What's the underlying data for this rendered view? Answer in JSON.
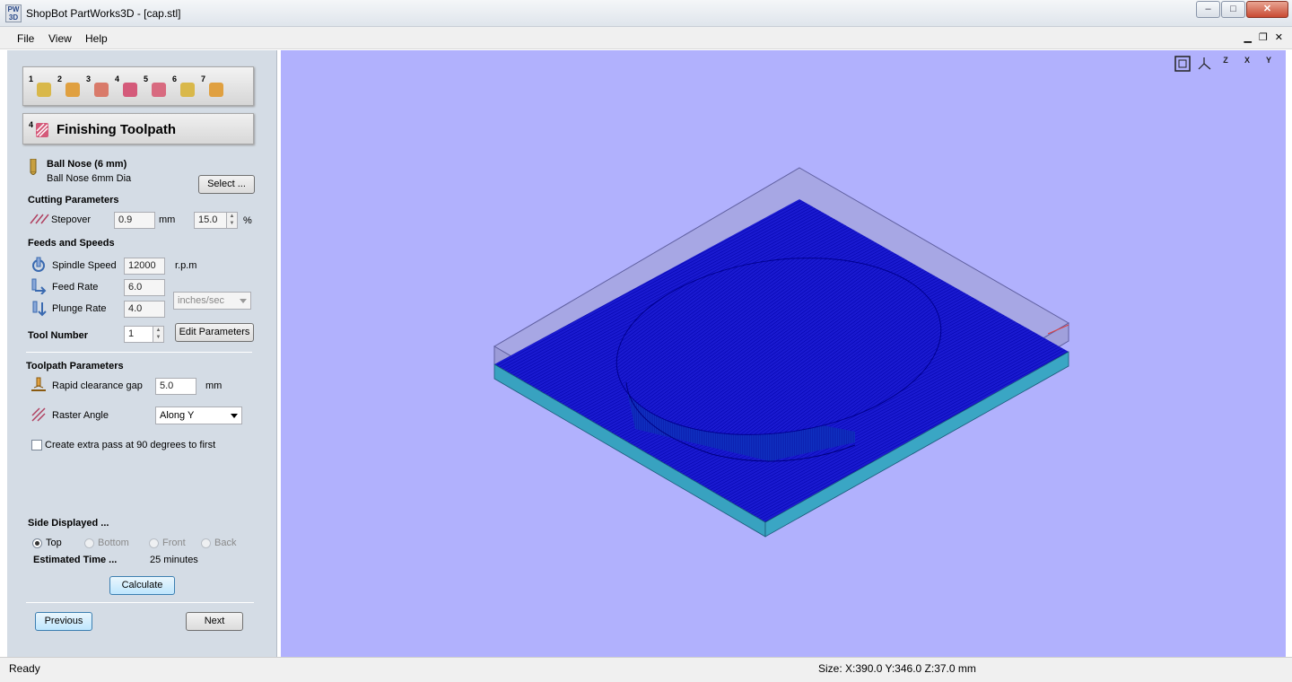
{
  "window": {
    "app_logo": "PW 3D",
    "title": "ShopBot PartWorks3D - [cap.stl]",
    "minimize": "–",
    "maximize": "□",
    "close": "✕"
  },
  "menu": {
    "items": [
      "File",
      "View",
      "Help"
    ]
  },
  "steps": [
    {
      "num": "1",
      "icon": "model-icon",
      "color": "#d9b84a"
    },
    {
      "num": "2",
      "icon": "orient-icon",
      "color": "#e0a040"
    },
    {
      "num": "3",
      "icon": "roughing-icon",
      "color": "#d97a6a"
    },
    {
      "num": "4",
      "icon": "finishing-icon",
      "color": "#d45a7a"
    },
    {
      "num": "5",
      "icon": "cutout-icon",
      "color": "#d86a80"
    },
    {
      "num": "6",
      "icon": "preview-icon",
      "color": "#d9b84a"
    },
    {
      "num": "7",
      "icon": "save-icon",
      "color": "#e0a040"
    }
  ],
  "panel": {
    "title": "Finishing Toolpath",
    "tool": {
      "name": "Ball Nose (6 mm)",
      "desc": "Ball Nose 6mm Dia",
      "select_label": "Select ..."
    },
    "cutting": {
      "header": "Cutting Parameters",
      "stepover_label": "Stepover",
      "stepover_value": "0.9",
      "stepover_unit": "mm",
      "stepover_pct": "15.0",
      "pct_unit": "%"
    },
    "feeds": {
      "header": "Feeds and Speeds",
      "spindle_label": "Spindle Speed",
      "spindle_value": "12000",
      "spindle_unit": "r.p.m",
      "feed_label": "Feed Rate",
      "feed_value": "6.0",
      "plunge_label": "Plunge Rate",
      "plunge_value": "4.0",
      "rate_unit": "inches/sec",
      "tool_number_label": "Tool Number",
      "tool_number_value": "1",
      "edit_params_label": "Edit Parameters"
    },
    "toolpath": {
      "header": "Toolpath Parameters",
      "rapid_label": "Rapid clearance gap",
      "rapid_value": "5.0",
      "rapid_unit": "mm",
      "raster_label": "Raster Angle",
      "raster_value": "Along Y",
      "extra_pass_label": "Create extra pass at 90 degrees to first"
    },
    "side": {
      "header": "Side Displayed ...",
      "options": [
        "Top",
        "Bottom",
        "Front",
        "Back"
      ],
      "selected": "Top",
      "est_label": "Estimated Time ...",
      "est_value": "25 minutes",
      "calculate_label": "Calculate"
    },
    "nav": {
      "previous_label": "Previous",
      "next_label": "Next"
    }
  },
  "view_icons": [
    "fit-view-icon",
    "iso-view-icon",
    "top-view-icon",
    "front-view-icon",
    "side-view-icon"
  ],
  "view_icon_labels": [
    "",
    "",
    "Z",
    "X",
    "Y"
  ],
  "status": {
    "left": "Ready",
    "right": "Size: X:390.0 Y:346.0 Z:37.0 mm"
  },
  "colors": {
    "viewport_bg": "#b1b1fd",
    "toolpath": "#0000c8",
    "material_side": "#3aa0b8"
  }
}
